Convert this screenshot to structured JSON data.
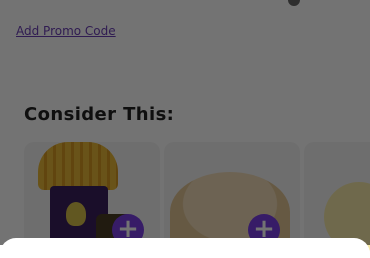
{
  "promo": {
    "label": "Add Promo Code"
  },
  "section": {
    "title": "Consider This:"
  },
  "recommendations": [
    {
      "name": "fries-meal",
      "add_label": "+"
    },
    {
      "name": "fries-bag",
      "add_label": "+"
    },
    {
      "name": "partial-item",
      "add_label": ""
    }
  ],
  "colors": {
    "accent": "#7b3fe4",
    "overlay": "rgba(0,0,0,0.55)",
    "link": "#6b3fb5"
  },
  "icons": {
    "top": "status-icon"
  }
}
